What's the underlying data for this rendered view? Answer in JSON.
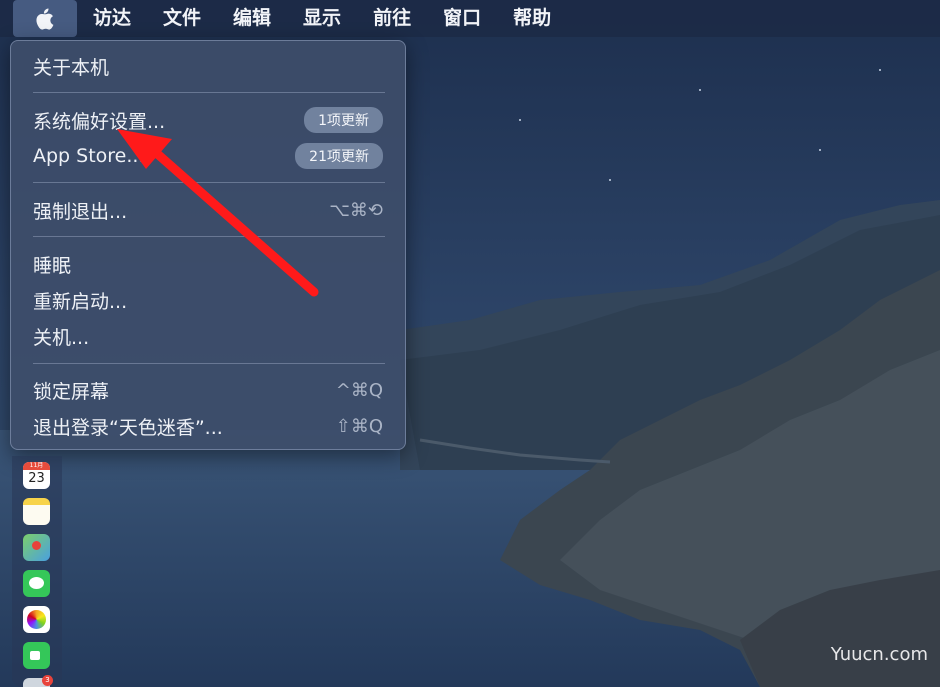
{
  "menubar": {
    "items": [
      {
        "label": "访达",
        "bold": true
      },
      {
        "label": "文件"
      },
      {
        "label": "编辑"
      },
      {
        "label": "显示"
      },
      {
        "label": "前往"
      },
      {
        "label": "窗口"
      },
      {
        "label": "帮助"
      }
    ]
  },
  "apple_menu": {
    "about": "关于本机",
    "system_prefs": {
      "label": "系统偏好设置...",
      "badge": "1项更新"
    },
    "app_store": {
      "label": "App Store...",
      "badge": "21项更新"
    },
    "force_quit": {
      "label": "强制退出...",
      "shortcut": "⌥⌘⟲"
    },
    "sleep": "睡眠",
    "restart": "重新启动...",
    "shutdown": "关机...",
    "lock_screen": {
      "label": "锁定屏幕",
      "shortcut": "^⌘Q"
    },
    "logout": {
      "label": "退出登录“天色迷香”...",
      "shortcut": "⇧⌘Q"
    }
  },
  "dock": {
    "calendar_month": "11月",
    "calendar_day": "23",
    "photos_badge": "3"
  },
  "watermark": "Yuucn.com",
  "colors": {
    "annotation_arrow": "#ff1a1a",
    "menu_background": "#3e4e6a"
  }
}
